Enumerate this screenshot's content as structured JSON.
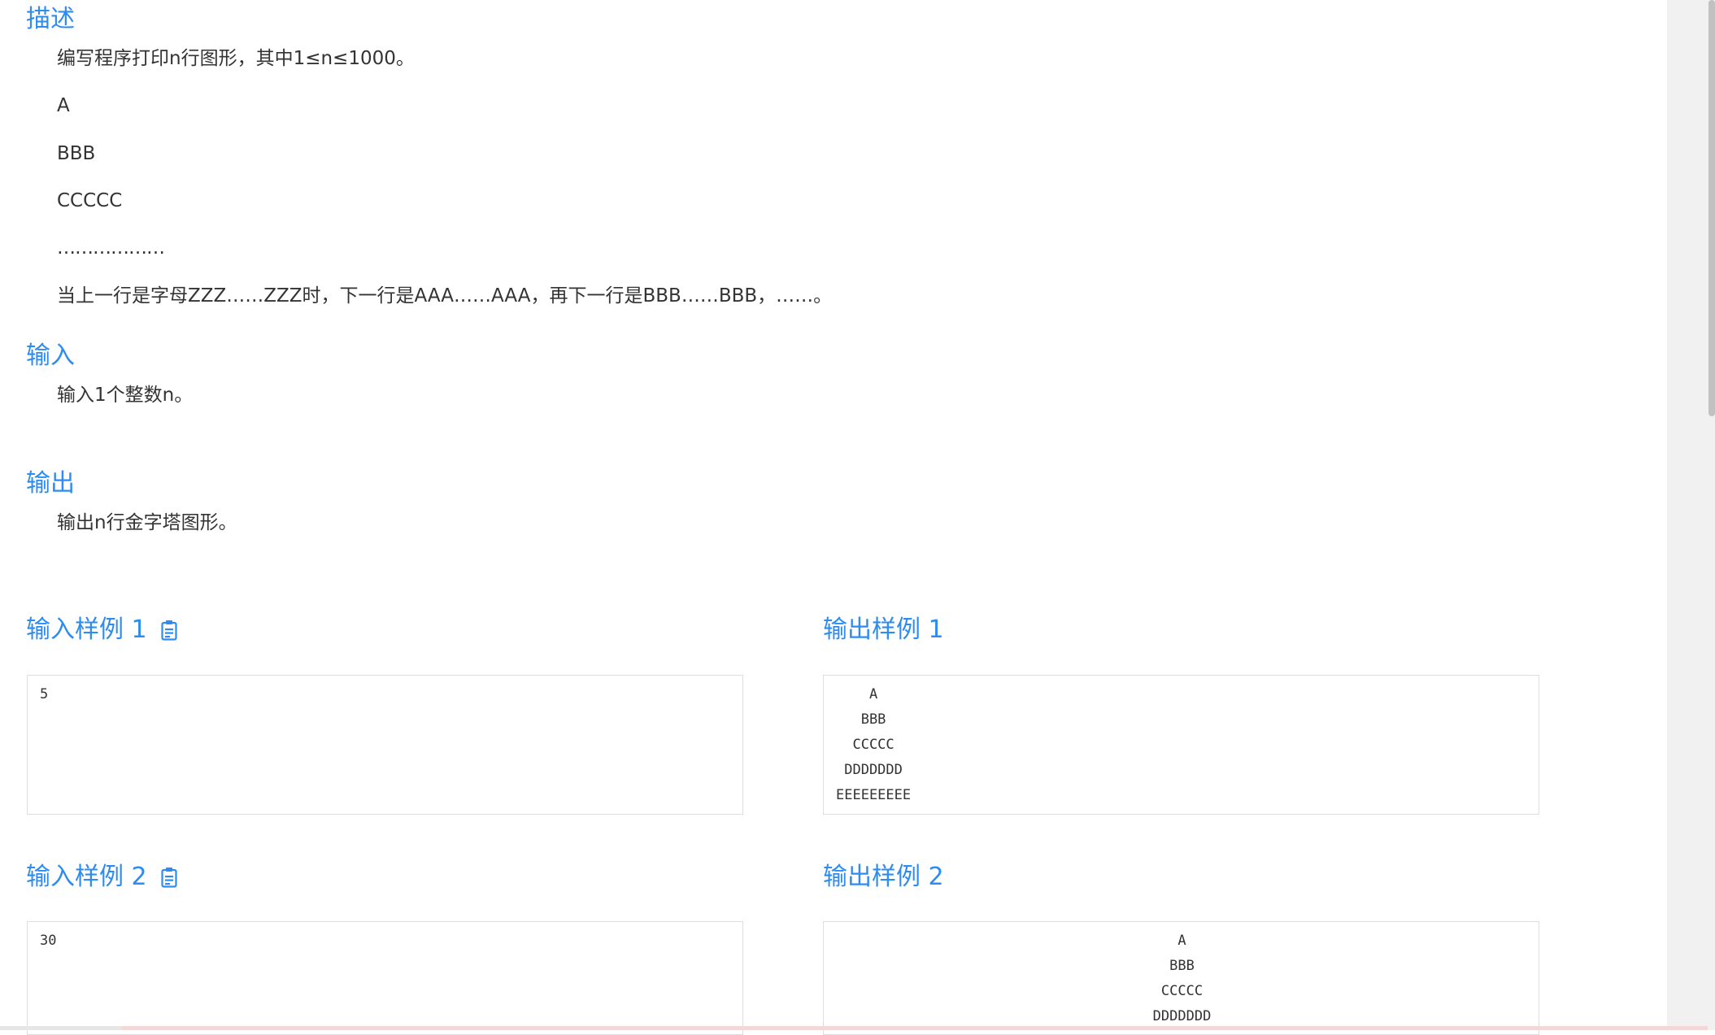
{
  "description": {
    "title": "描述",
    "lines": [
      "编写程序打印n行图形，其中1≤n≤1000。",
      "A",
      "BBB",
      "CCCCC",
      "………………",
      "当上一行是字母ZZZ……ZZZ时，下一行是AAA……AAA，再下一行是BBB……BBB，……。"
    ]
  },
  "input": {
    "title": "输入",
    "text": "输入1个整数n。"
  },
  "output": {
    "title": "输出",
    "text": "输出n行金字塔图形。"
  },
  "samples": [
    {
      "input_title": "输入样例 1",
      "input_value": "5",
      "output_title": "输出样例 1",
      "output_value": "    A\n   BBB\n  CCCCC\n DDDDDDD\nEEEEEEEEE"
    },
    {
      "input_title": "输入样例 2",
      "input_value": "30",
      "output_title": "输出样例 2",
      "output_value": "A\nBBB\nCCCCC\nDDDDDDD"
    }
  ],
  "icons": {
    "copy": "clipboard-icon"
  },
  "colors": {
    "heading": "#2d8cf0",
    "text": "#333333",
    "border": "#dcdee2"
  }
}
